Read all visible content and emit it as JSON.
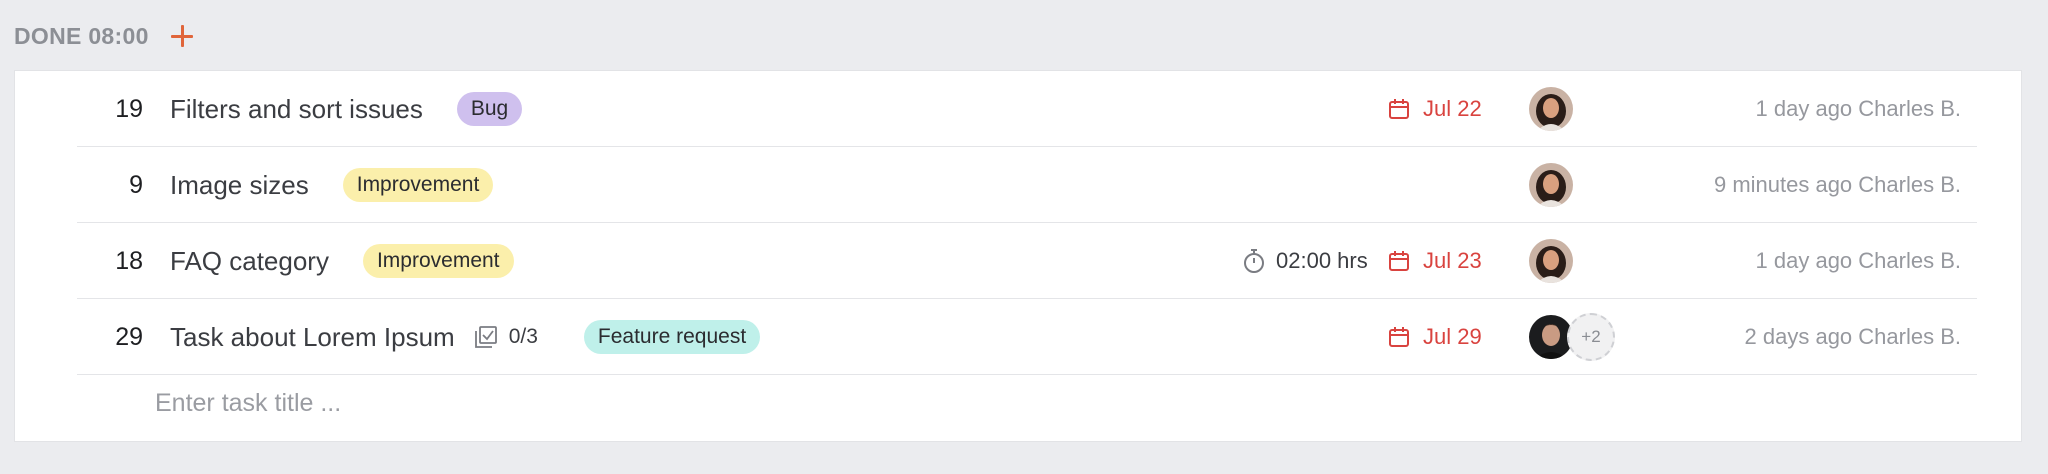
{
  "section": {
    "title": "DONE 08:00",
    "add_icon": "plus-icon",
    "accent_color": "#e0653a"
  },
  "tasks": [
    {
      "number": "19",
      "title": "Filters and sort issues",
      "tag": "Bug",
      "due": "Jul 22",
      "assignee_icon": "avatar-woman",
      "activity": "1 day ago Charles B."
    },
    {
      "number": "9",
      "title": "Image sizes",
      "tag": "Improvement",
      "assignee_icon": "avatar-woman",
      "activity": "9 minutes ago Charles B."
    },
    {
      "number": "18",
      "title": "FAQ category",
      "tag": "Improvement",
      "time_tracked": "02:00 hrs",
      "due": "Jul 23",
      "assignee_icon": "avatar-woman",
      "activity": "1 day ago Charles B."
    },
    {
      "number": "29",
      "title": "Task about Lorem Ipsum",
      "checklist": "0/3",
      "tag": "Feature request",
      "due": "Jul 29",
      "assignee_icon": "avatar-man",
      "extra_assignees": "+2",
      "activity": "2 days ago Charles B."
    }
  ],
  "new_task": {
    "placeholder": "Enter task title ..."
  },
  "colors": {
    "bug_tag": "#cfc0ee",
    "improvement_tag": "#fbefab",
    "feature_tag": "#bff0ea",
    "due_date": "#d9433f"
  }
}
